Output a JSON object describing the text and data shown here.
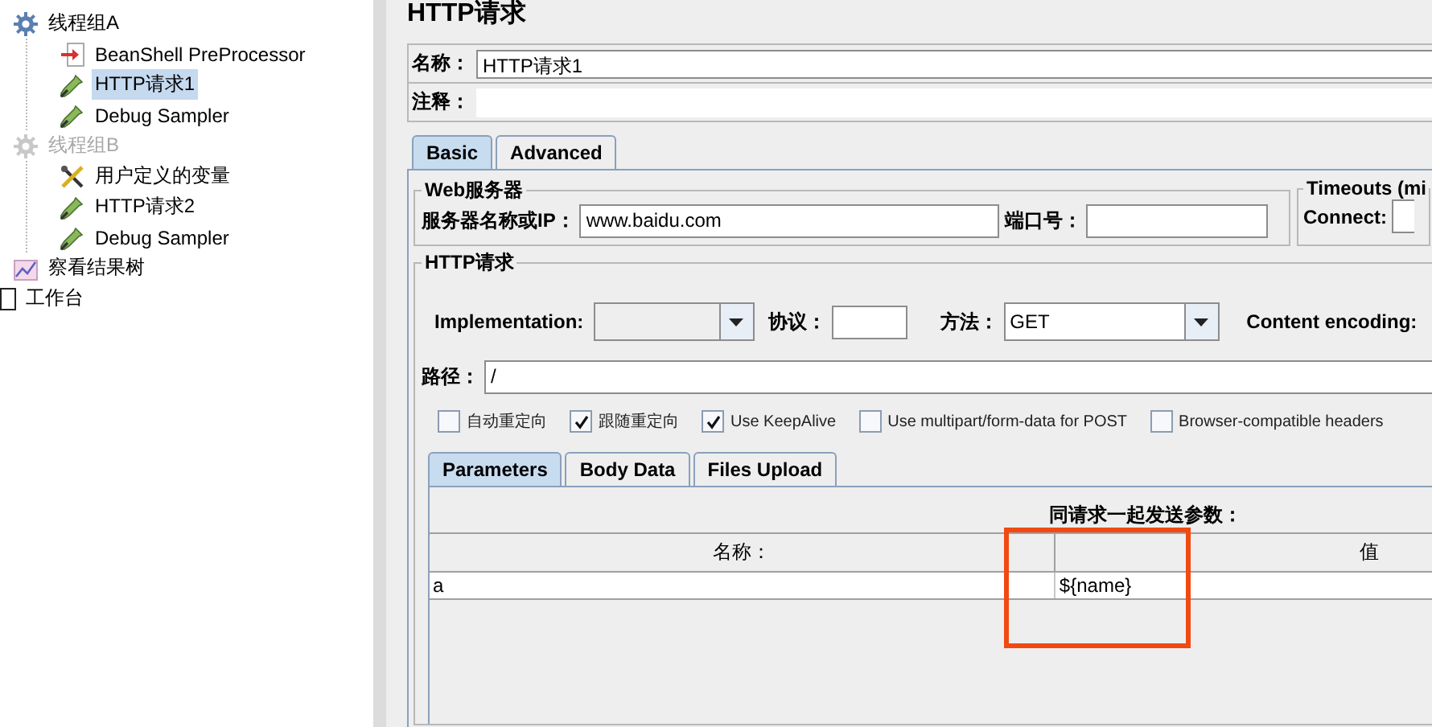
{
  "tree": [
    {
      "label": "线程组A",
      "kind": "thread-group",
      "selected": false,
      "disabled": false,
      "children": [
        {
          "label": "BeanShell PreProcessor",
          "kind": "preprocessor",
          "selected": false,
          "disabled": false
        },
        {
          "label": "HTTP请求1",
          "kind": "sampler",
          "selected": true,
          "disabled": false
        },
        {
          "label": "Debug Sampler",
          "kind": "sampler",
          "selected": false,
          "disabled": false
        }
      ]
    },
    {
      "label": "线程组B",
      "kind": "thread-group",
      "selected": false,
      "disabled": true,
      "children": [
        {
          "label": "用户定义的变量",
          "kind": "config",
          "selected": false,
          "disabled": false
        },
        {
          "label": "HTTP请求2",
          "kind": "sampler",
          "selected": false,
          "disabled": false
        },
        {
          "label": "Debug Sampler",
          "kind": "sampler",
          "selected": false,
          "disabled": false
        }
      ]
    },
    {
      "label": "察看结果树",
      "kind": "listener",
      "selected": false,
      "disabled": false
    }
  ],
  "workbench": {
    "label": "工作台"
  },
  "panel_title": "HTTP请求",
  "name_field": {
    "label": "名称：",
    "value": "HTTP请求1"
  },
  "comment_field": {
    "label": "注释："
  },
  "tabs": [
    {
      "label": "Basic",
      "selected": true
    },
    {
      "label": "Advanced",
      "selected": false
    }
  ],
  "web_server": {
    "title": "Web服务器",
    "server_label": "服务器名称或IP：",
    "server_value": "www.baidu.com",
    "port_label": "端口号："
  },
  "timeouts": {
    "title": "Timeouts (mi",
    "connect_label": "Connect:"
  },
  "http_request": {
    "title": "HTTP请求",
    "implementation_label": "Implementation:",
    "protocol_label": "协议：",
    "method_label": "方法：",
    "method_value": "GET",
    "encoding_label": "Content encoding:",
    "path_label": "路径：",
    "path_value": "/"
  },
  "options": [
    {
      "label": "自动重定向",
      "checked": false
    },
    {
      "label": "跟随重定向",
      "checked": true
    },
    {
      "label": "Use KeepAlive",
      "checked": true
    },
    {
      "label": "Use multipart/form-data for POST",
      "checked": false
    },
    {
      "label": "Browser-compatible headers",
      "checked": false
    }
  ],
  "sub_tabs": [
    {
      "label": "Parameters",
      "selected": true
    },
    {
      "label": "Body Data",
      "selected": false
    },
    {
      "label": "Files Upload",
      "selected": false
    }
  ],
  "parameters": {
    "title": "同请求一起发送参数：",
    "columns": [
      "名称：",
      "值"
    ],
    "rows": [
      [
        "a",
        "${name}"
      ]
    ]
  }
}
